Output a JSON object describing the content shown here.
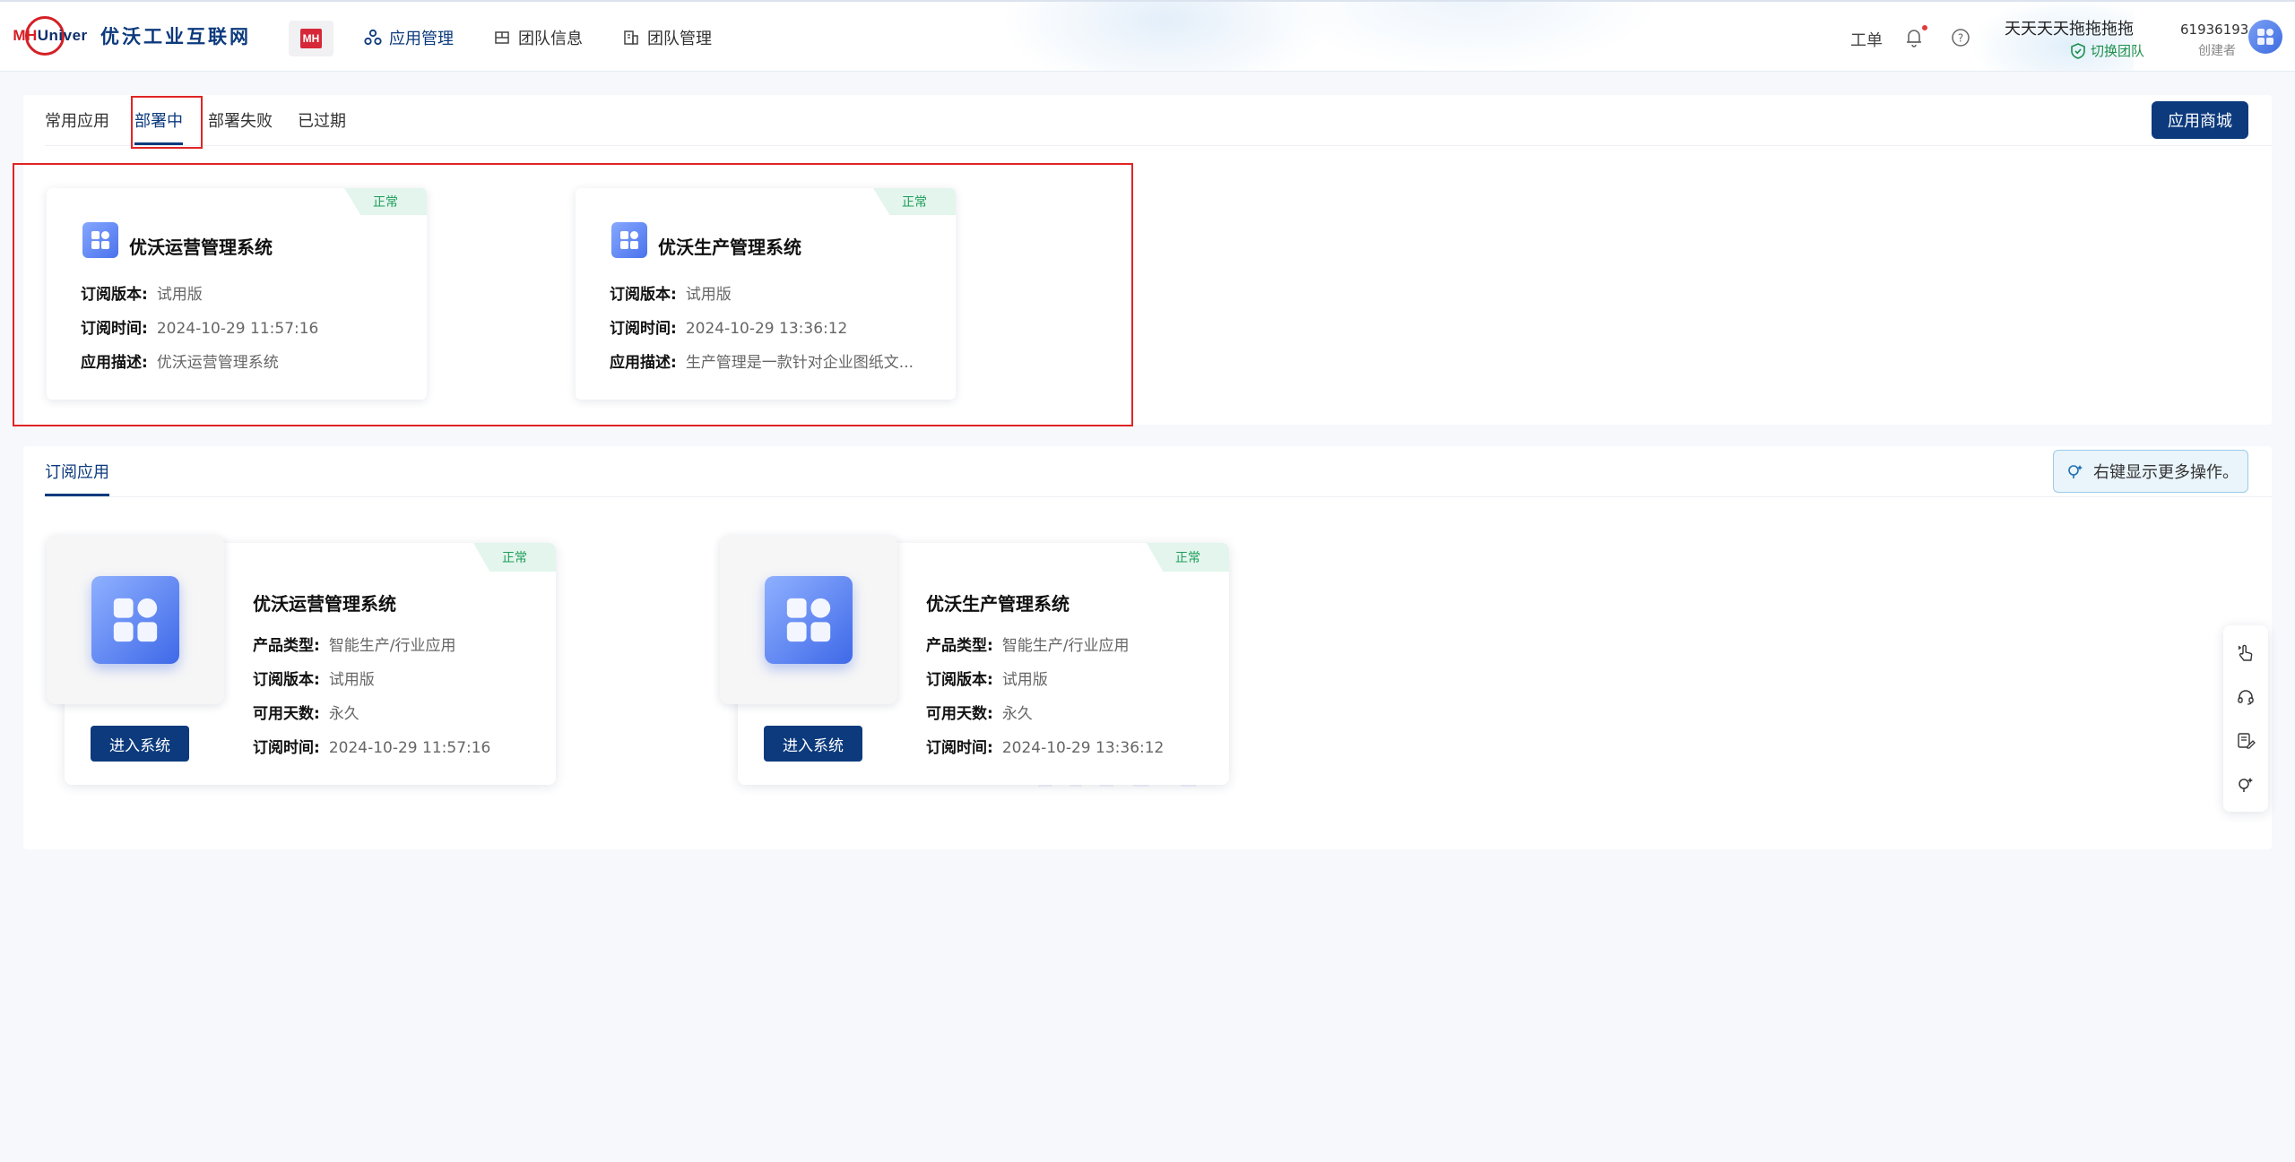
{
  "header": {
    "logo_text_red": "MH",
    "logo_text_blue": "Univer",
    "logo_cn": "优沃工业互联网",
    "badge_text": "MH",
    "nav": [
      {
        "label": "应用管理",
        "icon": "apps-icon"
      },
      {
        "label": "团队信息",
        "icon": "team-info-icon"
      },
      {
        "label": "团队管理",
        "icon": "building-icon"
      }
    ],
    "ticket": "工单",
    "user_name": "天天天天拖拖拖拖",
    "switch_team": "切换团队",
    "user_id": "61936193",
    "user_role": "创建者"
  },
  "deploy_panel": {
    "tabs": [
      "常用应用",
      "部署中",
      "部署失败",
      "已过期"
    ],
    "active_tab": "部署中",
    "store_button": "应用商城",
    "cards": [
      {
        "status": "正常",
        "title": "优沃运营管理系统",
        "version_label": "订阅版本:",
        "version": "试用版",
        "time_label": "订阅时间:",
        "time": "2024-10-29 11:57:16",
        "desc_label": "应用描述:",
        "desc": "优沃运营管理系统"
      },
      {
        "status": "正常",
        "title": "优沃生产管理系统",
        "version_label": "订阅版本:",
        "version": "试用版",
        "time_label": "订阅时间:",
        "time": "2024-10-29 13:36:12",
        "desc_label": "应用描述:",
        "desc": "生产管理是一款针对企业图纸文..."
      }
    ]
  },
  "subscribed_panel": {
    "tab": "订阅应用",
    "hint": "右键显示更多操作。",
    "cards": [
      {
        "status": "正常",
        "title": "优沃运营管理系统",
        "type_label": "产品类型:",
        "type": "智能生产/行业应用",
        "version_label": "订阅版本:",
        "version": "试用版",
        "days_label": "可用天数:",
        "days": "永久",
        "time_label": "订阅时间:",
        "time": "2024-10-29 11:57:16",
        "enter": "进入系统"
      },
      {
        "status": "正常",
        "title": "优沃生产管理系统",
        "type_label": "产品类型:",
        "type": "智能生产/行业应用",
        "version_label": "订阅版本:",
        "version": "试用版",
        "days_label": "可用天数:",
        "days": "永久",
        "time_label": "订阅时间:",
        "time": "2024-10-29 13:36:12",
        "enter": "进入系统"
      }
    ],
    "watermark": "MH"
  },
  "float_toolbar": [
    "touch-icon",
    "headset-icon",
    "edit-icon",
    "tip-icon"
  ],
  "colors": {
    "primary": "#0c3a7d",
    "status_green": "#1f9d5c",
    "highlight_red": "#e02424"
  }
}
